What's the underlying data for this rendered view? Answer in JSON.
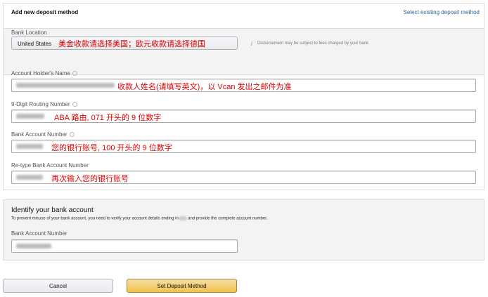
{
  "header": {
    "title": "Add new deposit method",
    "link": "Select existing deposit method"
  },
  "bank_location": {
    "label": "Bank Location",
    "value": "United States",
    "annotation": "美金收款请选择美国；欧元收款请选择德国",
    "note": "Disbursement may be subject to fees charged by your bank"
  },
  "fields": [
    {
      "label": "Account Holder's Name",
      "annotation": "收款人姓名(请填写英文)，以 Vcan 发出之邮件为准"
    },
    {
      "label": "9-Digit Routing Number",
      "annotation": "ABA 路由, 071 开头的 9 位数字"
    },
    {
      "label": "Bank Account Number",
      "annotation": "您的银行账号, 100 开头的 9 位数字"
    },
    {
      "label": "Re-type Bank Account Number",
      "annotation": "再次输入您的银行账号"
    }
  ],
  "identify": {
    "title": "Identify your bank account",
    "desc_before": "To prevent misuse of your bank account, you need to verify your account details ending in",
    "desc_after": "and provide the complete account number.",
    "label": "Bank Account Number"
  },
  "buttons": {
    "cancel": "Cancel",
    "submit": "Set Deposit Method"
  },
  "colors": {
    "link": "#2a6496",
    "annotation": "#e00000",
    "primary": "#f0c14b"
  }
}
